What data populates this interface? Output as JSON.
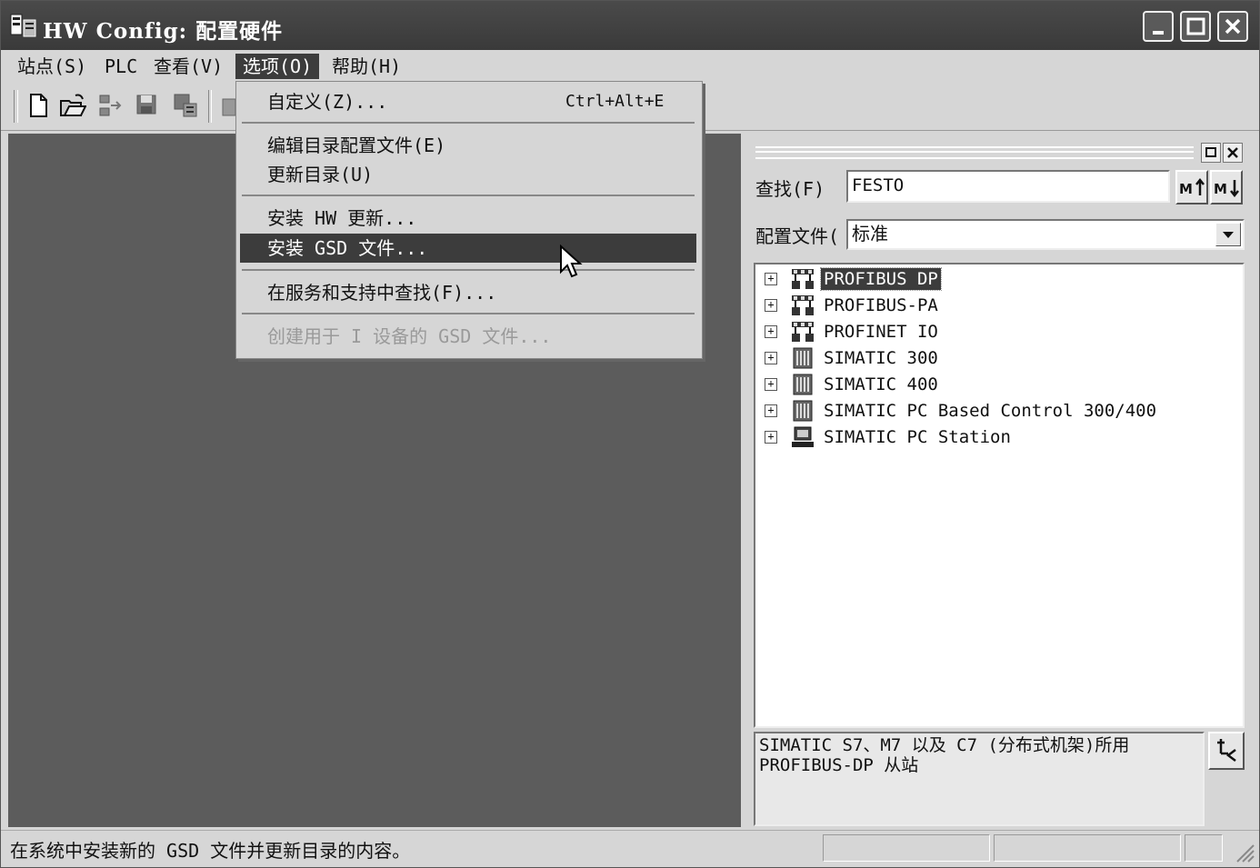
{
  "window": {
    "title": "HW Config: 配置硬件",
    "controls": {
      "minimize_icon": "minimize-icon",
      "maximize_icon": "maximize-icon",
      "close_icon": "close-icon"
    }
  },
  "menubar": {
    "items": [
      {
        "label": "站点(S)"
      },
      {
        "label": "PLC"
      },
      {
        "label": "查看(V)"
      },
      {
        "label": "选项(O)"
      },
      {
        "label": "帮助(H)"
      }
    ]
  },
  "options_menu": {
    "items": [
      {
        "label": "自定义(Z)...",
        "shortcut": "Ctrl+Alt+E"
      },
      {
        "label": "编辑目录配置文件(E)"
      },
      {
        "label": "更新目录(U)"
      },
      {
        "label": "安装 HW 更新..."
      },
      {
        "label": "安装 GSD 文件..."
      },
      {
        "label": "在服务和支持中查找(F)..."
      },
      {
        "label": "创建用于 I 设备的 GSD 文件..."
      }
    ]
  },
  "catalog": {
    "find_label": "查找(F)",
    "find_value": "FESTO",
    "profile_label": "配置文件(",
    "profile_value": "标准",
    "tree": [
      {
        "label": "PROFIBUS DP",
        "icon": "network-icon"
      },
      {
        "label": "PROFIBUS-PA",
        "icon": "network-icon"
      },
      {
        "label": "PROFINET IO",
        "icon": "network-icon"
      },
      {
        "label": "SIMATIC 300",
        "icon": "rack-icon"
      },
      {
        "label": "SIMATIC 400",
        "icon": "rack-icon"
      },
      {
        "label": "SIMATIC PC Based Control 300/400",
        "icon": "rack-icon"
      },
      {
        "label": "SIMATIC PC Station",
        "icon": "pc-icon"
      }
    ],
    "description_line1": "SIMATIC S7、M7 以及 C7 (分布式机架)所用",
    "description_line2": "PROFIBUS-DP 从站"
  },
  "statusbar": {
    "text": "在系统中安装新的 GSD 文件并更新目录的内容。"
  }
}
